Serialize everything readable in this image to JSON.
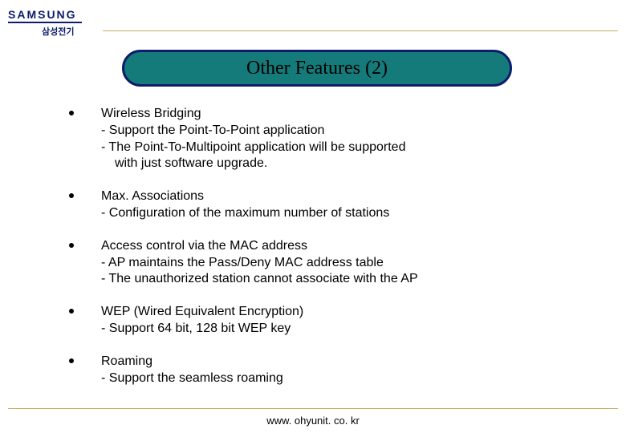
{
  "brand": {
    "name": "SAMSUNG",
    "sub": "삼성전기"
  },
  "title": "Other Features (2)",
  "bullets": [
    {
      "heading": "Wireless Bridging",
      "subs": [
        "- Support the Point-To-Point application",
        "- The Point-To-Multipoint application will be supported",
        "  with just software upgrade."
      ]
    },
    {
      "heading": "Max. Associations",
      "subs": [
        "- Configuration of the maximum number of stations"
      ]
    },
    {
      "heading": "Access control via the MAC address",
      "subs": [
        "- AP maintains the Pass/Deny MAC address table",
        "- The unauthorized station cannot associate with the AP"
      ]
    },
    {
      "heading": "WEP (Wired Equivalent Encryption)",
      "subs": [
        "- Support 64 bit, 128 bit WEP key"
      ]
    },
    {
      "heading": "Roaming",
      "subs": [
        "- Support the seamless roaming"
      ]
    }
  ],
  "footer": "www. ohyunit. co. kr"
}
